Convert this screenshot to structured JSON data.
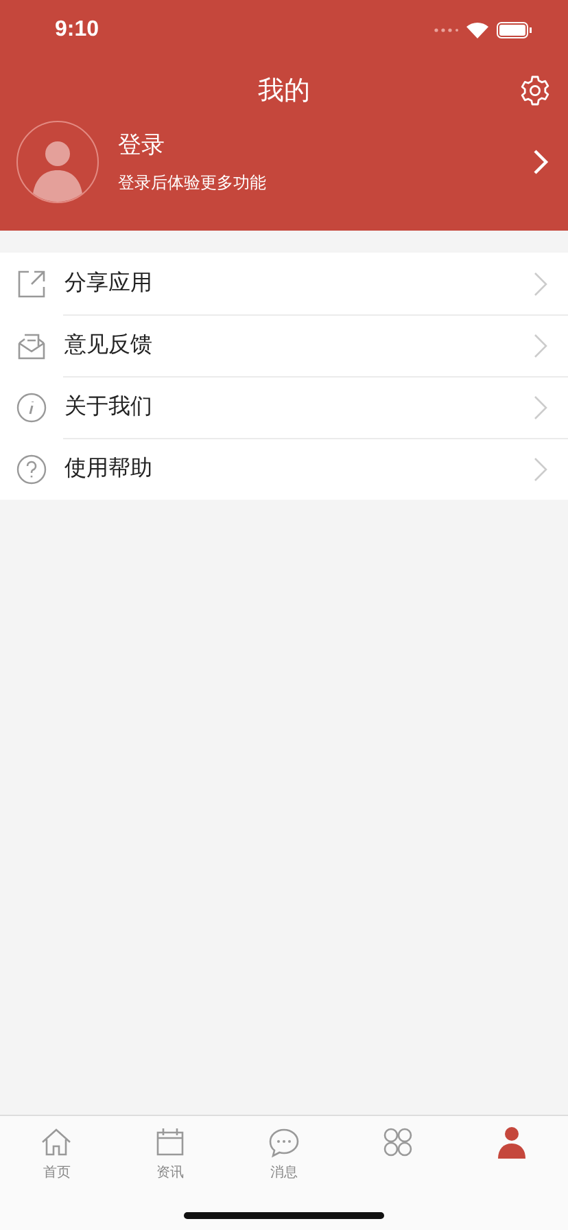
{
  "status_bar": {
    "time": "9:10"
  },
  "header": {
    "title": "我的"
  },
  "profile": {
    "name": "登录",
    "subtitle": "登录后体验更多功能"
  },
  "menu": [
    {
      "kind": "share",
      "label": "分享应用"
    },
    {
      "kind": "feedback",
      "label": "意见反馈"
    },
    {
      "kind": "info",
      "label": "关于我们"
    },
    {
      "kind": "help",
      "label": "使用帮助"
    }
  ],
  "tab_bar": [
    {
      "kind": "home",
      "label": "首页",
      "selected": false
    },
    {
      "kind": "news",
      "label": "资讯",
      "selected": false
    },
    {
      "kind": "messages",
      "label": "消息",
      "selected": false
    },
    {
      "kind": "apps",
      "selected": false
    },
    {
      "kind": "me",
      "selected": true
    }
  ]
}
